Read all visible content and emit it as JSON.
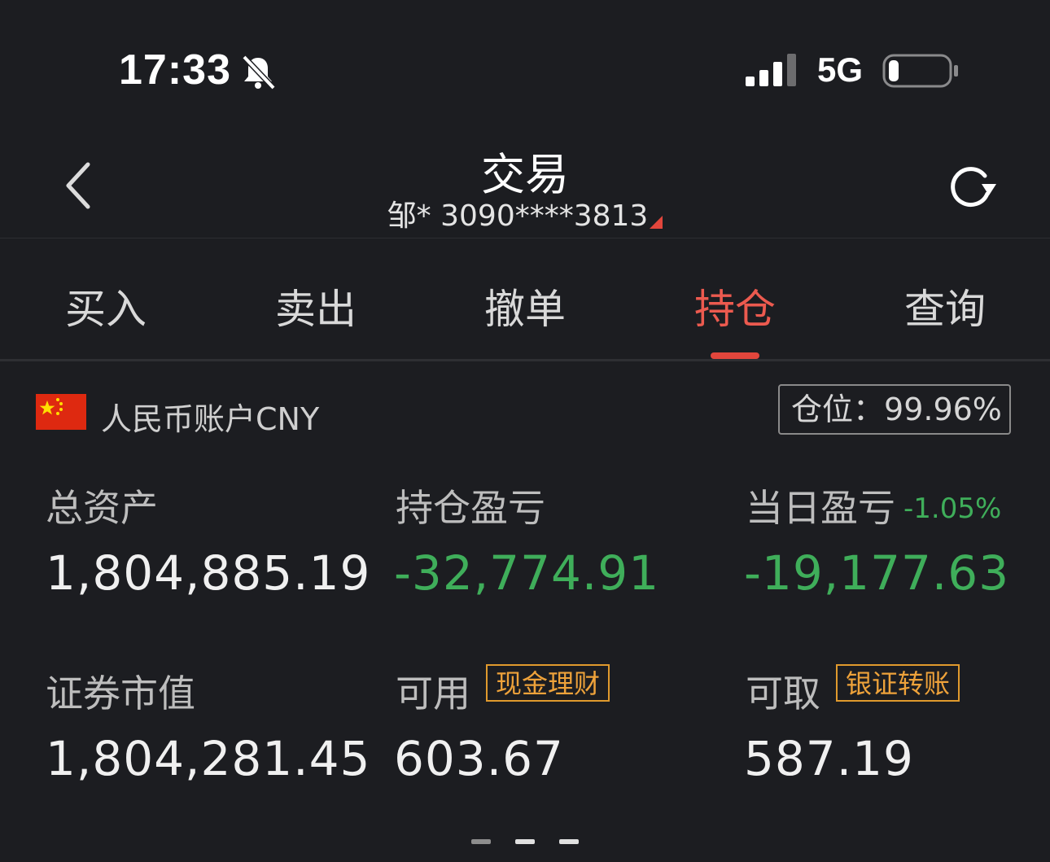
{
  "status_bar": {
    "time": "17:33",
    "network": "5G"
  },
  "nav": {
    "title": "交易",
    "account": "邹* 3090****3813"
  },
  "tabs": [
    {
      "label": "买入"
    },
    {
      "label": "卖出"
    },
    {
      "label": "撤单"
    },
    {
      "label": "持仓",
      "active": true
    },
    {
      "label": "查询"
    }
  ],
  "account": {
    "currency_label": "人民币账户CNY",
    "position_label": "仓位：",
    "position_value": "99.96%"
  },
  "metrics": {
    "total_assets": {
      "label": "总资产",
      "value": "1,804,885.19"
    },
    "holding_pnl": {
      "label": "持仓盈亏",
      "value": "-32,774.91"
    },
    "daily_pnl": {
      "label": "当日盈亏",
      "percent": "-1.05%",
      "value": "-19,177.63"
    },
    "market_value": {
      "label": "证券市值",
      "value": "1,804,281.45"
    },
    "available": {
      "label": "可用",
      "tag": "现金理财",
      "value": "603.67"
    },
    "withdrawable": {
      "label": "可取",
      "tag": "银证转账",
      "value": "587.19"
    }
  },
  "colors": {
    "accent_red": "#e2463c",
    "loss_green": "#3fae5a",
    "tag_orange": "#e09a2d",
    "background": "#1c1d21"
  },
  "pagination": {
    "pages": 3,
    "current": 2
  }
}
